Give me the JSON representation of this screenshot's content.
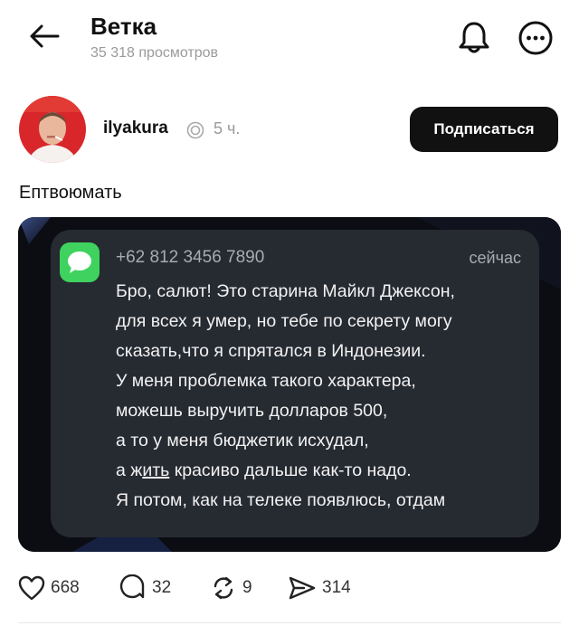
{
  "header": {
    "title": "Ветка",
    "subtitle": "35 318 просмотров"
  },
  "post": {
    "author": "ilyakura",
    "time": "5 ч.",
    "follow_label": "Подписаться",
    "text": "Ептвоюмать"
  },
  "notification": {
    "sender": "+62 812 3456 7890",
    "time": "сейчас",
    "lines": [
      "Бро, салют! Это старина Майкл Джексон,",
      "для всех я умер, но тебе по секрету могу",
      "сказать,что я спрятался в Индонезии.",
      "У меня проблемка такого характера,",
      "можешь выручить долларов 500,",
      "а то у меня бюджетик исхудал,",
      "а жить красиво дальше как-то надо.",
      "Я потом, как на телеке появлюсь, отдам"
    ],
    "line7_parts": {
      "pre": "а ж",
      "underlined": "ить",
      "post": " красиво дальше как-то надо."
    }
  },
  "actions": {
    "likes": "668",
    "comments": "32",
    "reposts": "9",
    "shares": "314"
  },
  "colors": {
    "accent": "#111111",
    "muted": "#9a9a9a",
    "imessage_green": "#3fd25e",
    "notification_bg": "#262a31"
  },
  "icons": [
    "back-arrow-icon",
    "bell-icon",
    "more-icon",
    "verified-icon",
    "messages-app-icon",
    "heart-icon",
    "comment-icon",
    "repost-icon",
    "share-icon"
  ]
}
